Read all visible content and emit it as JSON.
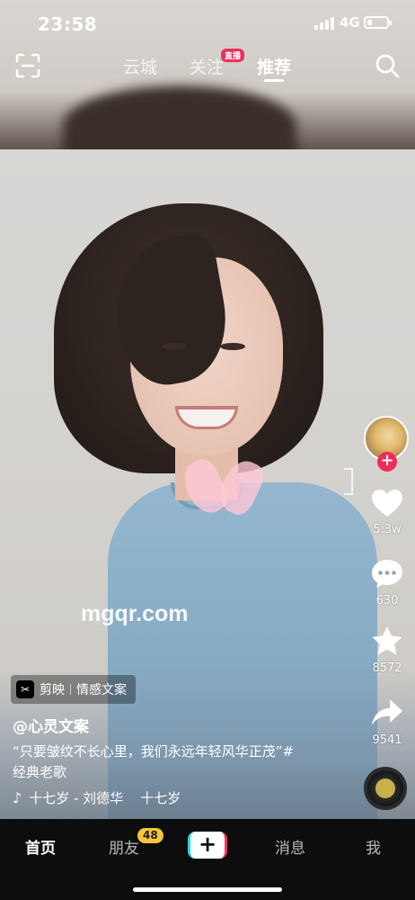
{
  "status_bar": {
    "time": "23:58",
    "network": "4G",
    "battery_percent": 20
  },
  "top_nav": {
    "tabs": [
      {
        "label": "云城",
        "active": false
      },
      {
        "label": "关注",
        "active": false,
        "badge": "直播"
      },
      {
        "label": "推荐",
        "active": true
      }
    ],
    "icons": {
      "left": "scan-icon",
      "right": "search-icon"
    }
  },
  "watermark": "mgqr.com",
  "right_rail": {
    "likes": "5.3w",
    "comments": "630",
    "favorites": "8572",
    "shares": "9541",
    "follow_icon": "plus-icon"
  },
  "caption": {
    "app_tag": {
      "app": "剪映",
      "template": "情感文案"
    },
    "author": "@心灵文案",
    "text_line1": "“只要皱纹不长心里，我们永远年轻风华正茂”#",
    "text_line2": "经典老歌",
    "music": "十七岁 - 刘德华    十七岁"
  },
  "tab_bar": {
    "home": "首页",
    "friends": "朋友",
    "friends_badge": "48",
    "create": "+",
    "messages": "消息",
    "me": "我"
  },
  "colors": {
    "accent_red": "#ee2c55",
    "badge_yellow": "#f7c43a",
    "tabbar_bg": "#0d0d0d"
  }
}
